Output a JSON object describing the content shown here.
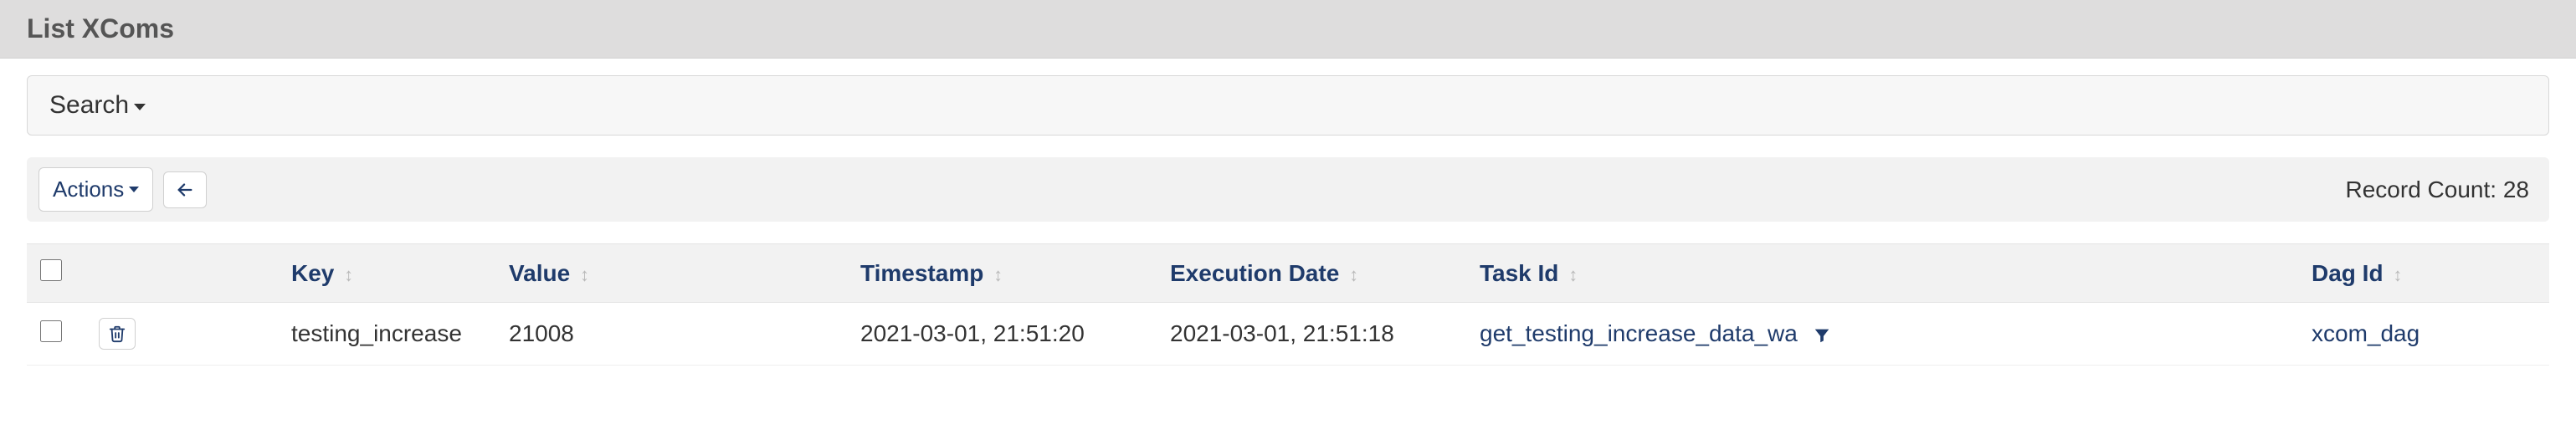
{
  "header": {
    "title": "List XComs"
  },
  "search": {
    "label": "Search"
  },
  "toolbar": {
    "actions_label": "Actions",
    "record_count_label": "Record Count:",
    "record_count_value": "28"
  },
  "columns": {
    "key": "Key",
    "value": "Value",
    "timestamp": "Timestamp",
    "execution_date": "Execution Date",
    "task_id": "Task Id",
    "dag_id": "Dag Id"
  },
  "rows": [
    {
      "key": "testing_increase",
      "value": "21008",
      "timestamp": "2021-03-01, 21:51:20",
      "execution_date": "2021-03-01, 21:51:18",
      "task_id": "get_testing_increase_data_wa",
      "dag_id": "xcom_dag"
    }
  ]
}
